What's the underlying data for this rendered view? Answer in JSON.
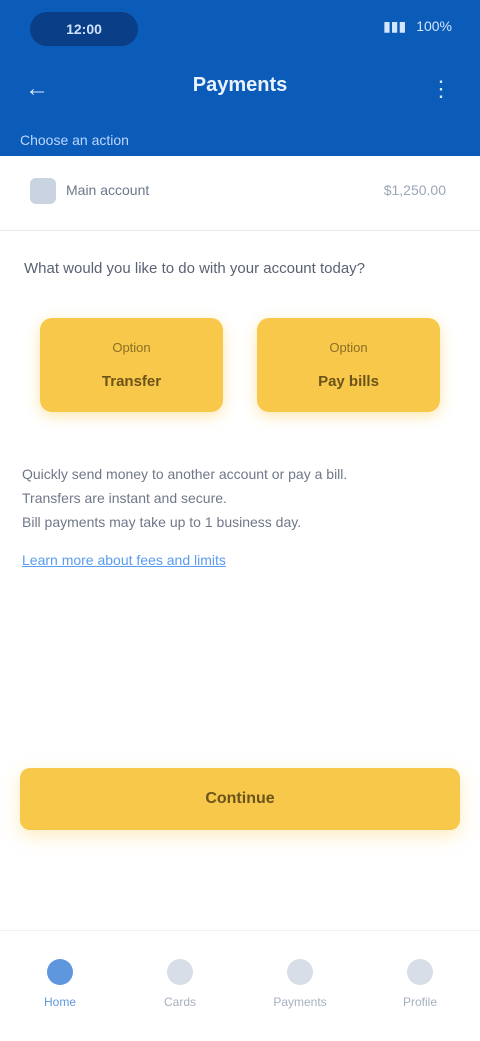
{
  "status": {
    "time": "12:00",
    "battery": "100%"
  },
  "header": {
    "title": "Payments",
    "subtitle": "Choose an action"
  },
  "account": {
    "label": "Main account",
    "balance": "$1,250.00"
  },
  "prompt": {
    "text": "What would you like to do with your account today?"
  },
  "actions": [
    {
      "small": "Option",
      "label": "Transfer"
    },
    {
      "small": "Option",
      "label": "Pay bills"
    }
  ],
  "info": {
    "lines": [
      "Quickly send money to another account or pay a bill.",
      "Transfers are instant and secure.",
      "Bill payments may take up to 1 business day."
    ],
    "link": "Learn more about fees and limits"
  },
  "primary": {
    "label": "Continue"
  },
  "nav": {
    "items": [
      "Home",
      "Cards",
      "Payments",
      "Profile"
    ]
  }
}
